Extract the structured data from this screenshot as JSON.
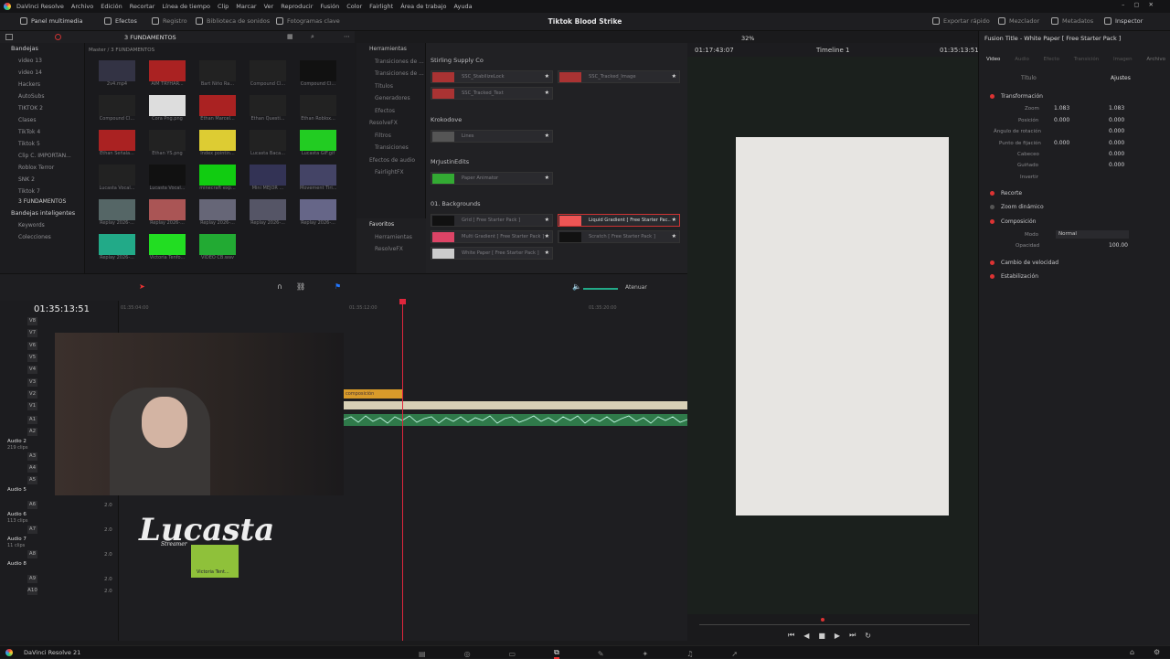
{
  "menu": [
    "DaVinci Resolve",
    "Archivo",
    "Edición",
    "Recortar",
    "Línea de tiempo",
    "Clip",
    "Marcar",
    "Ver",
    "Reproducir",
    "Fusión",
    "Color",
    "Fairlight",
    "Área de trabajo",
    "Ayuda"
  ],
  "topbar": {
    "media_pool": "Panel multimedia",
    "effects": "Efectos",
    "index": "Registro",
    "sound_library": "Biblioteca de sonidos",
    "keyframes": "Fotogramas clave",
    "project_title": "Tiktok Blood Strike",
    "quick_export": "Exportar rápido",
    "mixer": "Mezclador",
    "metadata": "Metadatos",
    "inspector": "Inspector"
  },
  "media": {
    "breadcrumb": "3 FUNDAMENTOS",
    "path": "Master / 3 FUNDAMENTOS",
    "bins_title": "Bandejas",
    "bins": [
      "video 13",
      "video 14",
      "Hackers",
      "AutoSubs",
      "TIKTOK 2",
      "Clases",
      "TikTok 4",
      "Tiktok 5",
      "Clip C. IMPORTAN...",
      "Roblox Terror",
      "SNK 2",
      "Tiktok 7",
      "3 FUNDAMENTOS"
    ],
    "smart_bins_title": "Bandejas inteligentes",
    "smart_bins": [
      "Keywords",
      "Colecciones"
    ],
    "thumbs": [
      "2v4.mp4",
      "AIM TRYHAR...",
      "Bart Niño Ra...",
      "Compound Cl...",
      "Compound Cl...",
      "Compound Cl...",
      "Cora Png.png",
      "Ethan Marcel...",
      "Ethan Questi...",
      "Ethan Roblox...",
      "Ethan Señala...",
      "Ethan YS.png",
      "Index pointin...",
      "Lucasta Baca...",
      "Lucasta GIF.gif",
      "Lucasta Vocal...",
      "Lucasta Vocal...",
      "minecraft exp...",
      "Mini MEJOR ...",
      "Movement Tiri...",
      "Replay 2026-...",
      "Replay 2026-...",
      "Replay 2026-...",
      "Replay 2026-...",
      "Replay 2026-...",
      "Replay 2026-...",
      "Victoria Tenfo...",
      "VIDEO CB.wav"
    ]
  },
  "effects": {
    "tree": [
      "Herramientas",
      "Transiciones de ...",
      "Transiciones de ...",
      "Títulos",
      "Generadores",
      "Efectos",
      "ResolveFX",
      "Filtros",
      "Transiciones",
      "Efectos de audio",
      "FairlightFX"
    ],
    "favorites": "Favoritos",
    "fav_items": [
      "Herramientas",
      "ResolveFX"
    ],
    "groups": [
      "Stirling Supply Co",
      "Krokodove",
      "MrJustinEdits",
      "01. Backgrounds"
    ],
    "items": [
      "SSC_StabilizeLock",
      "SSC_Tracked_Image",
      "SSC_Tracked_Text",
      "Lines",
      "Paper Animator",
      "Grid [ Free Starter Pack ]",
      "Liquid Gradient [ Free Starter Pac...",
      "Multi Gradient [ Free Starter Pack ]",
      "Scratch [ Free Starter Pack ]",
      "White Paper [ Free Starter Pack ]"
    ]
  },
  "viewer": {
    "zoom": "32%",
    "timecode_left": "01:17:43:07",
    "timeline_name": "Timeline 1",
    "timecode_right": "01:35:13:51"
  },
  "inspector": {
    "title": "Fusion Title - White Paper [ Free Starter Pack ]",
    "tabs": [
      "Video",
      "Audio",
      "Efecto",
      "Transición",
      "Imagen",
      "Archivo"
    ],
    "subtabs": [
      "Título",
      "Ajustes"
    ],
    "sections": [
      "Transformación",
      "Recorte",
      "Zoom dinámico",
      "Composición",
      "Cambio de velocidad",
      "Estabilización"
    ],
    "params": {
      "zoom": "Zoom",
      "position": "Posición",
      "rotation": "Ángulo de rotación",
      "anchor": "Punto de fijación",
      "pitch": "Cabeceo",
      "yaw": "Guiñado",
      "flip": "Invertir",
      "mode": "Modo",
      "opacity": "Opacidad"
    },
    "values": {
      "zoom_x": "1.083",
      "zoom_y": "1.083",
      "pos_x": "0.000",
      "pos_y": "0.000",
      "rot": "0.000",
      "anchor_x": "0.000",
      "anchor_y": "0.000",
      "pitch": "0.000",
      "yaw": "0.000",
      "mode": "Normal",
      "opacity": "100.00"
    }
  },
  "timeline": {
    "timecode": "01:35:13:51",
    "ruler": [
      "01:35:04:00",
      "01:35:12:00",
      "01:35:20:00"
    ],
    "attenuate": "Atenuar",
    "video_tracks": [
      "V8",
      "V7",
      "V6",
      "V5",
      "V4",
      "V3",
      "V2",
      "V1"
    ],
    "audio_tracks": [
      {
        "id": "A1",
        "name": ""
      },
      {
        "id": "A2",
        "name": "Audio 2",
        "clips": "219 clips"
      },
      {
        "id": "A3",
        "name": ""
      },
      {
        "id": "A4",
        "name": ""
      },
      {
        "id": "A5",
        "name": "Audio 5"
      },
      {
        "id": "A6",
        "name": "Audio 6",
        "clips": "113 clips"
      },
      {
        "id": "A7",
        "name": "Audio 7",
        "clips": "11 clips"
      },
      {
        "id": "A8",
        "name": "Audio 8"
      },
      {
        "id": "A9",
        "name": ""
      },
      {
        "id": "A10",
        "name": ""
      }
    ],
    "level": "2.0",
    "clip_label": "composición",
    "overlay_clip": "Victoria Tent...",
    "webcam_logo": "Lucasta",
    "webcam_sub": "Streamer"
  },
  "bottom": {
    "app": "DaVinci Resolve 21"
  }
}
